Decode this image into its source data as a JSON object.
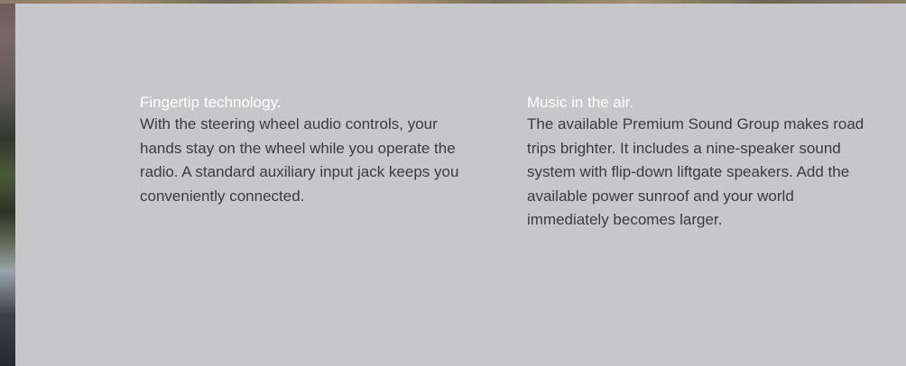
{
  "sections": [
    {
      "heading": "Fingertip technology.",
      "body": "With the steering wheel audio controls, your hands stay on the wheel while you operate the radio. A standard auxiliary input jack keeps you conveniently connected."
    },
    {
      "heading": "Music in the air.",
      "body": "The available Premium Sound Group makes road trips brighter. It includes a nine-speaker sound system with flip-down liftgate speakers. Add the available power sunroof and your world immediately becomes larger."
    }
  ],
  "colors": {
    "panel_background": "#c7c6c8",
    "heading_text": "#ffffff",
    "body_text": "#3c3c3e"
  }
}
